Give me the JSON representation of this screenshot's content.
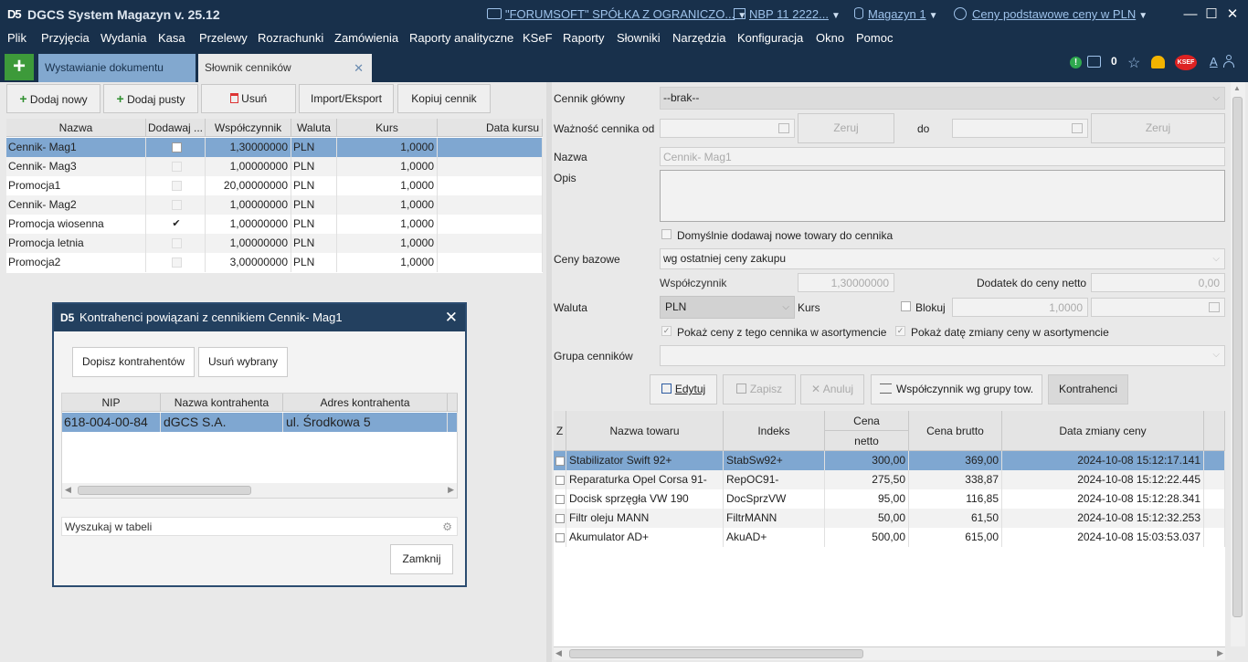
{
  "titlebar": {
    "logo": "D5",
    "title": "DGCS System Magazyn v. 25.12",
    "company": "\"FORUMSOFT\" SPÓŁKA Z OGRANICZO...",
    "nbp": "NBP 11 2222...",
    "warehouse": "Magazyn 1",
    "prices": "Ceny podstawowe ceny w PLN"
  },
  "menu": [
    "Plik",
    "Przyjęcia",
    "Wydania",
    "Kasa",
    "Przelewy",
    "Rozrachunki",
    "Zamówienia",
    "Raporty analityczne",
    "KSeF",
    "Raporty",
    "Słowniki",
    "Narzędzia",
    "Konfiguracja",
    "Okno",
    "Pomoc"
  ],
  "tabs": {
    "plus": "+",
    "tab1": "Wystawianie dokumentu",
    "tab2": "Słownik cenników",
    "close": "✕"
  },
  "status": {
    "count": "0",
    "ksef": "KSEF",
    "font": "A"
  },
  "toolbar": {
    "add_new": "Dodaj nowy",
    "add_empty": "Dodaj pusty",
    "delete": "Usuń",
    "import_export": "Import/Eksport",
    "copy": "Kopiuj cennik"
  },
  "pricelists": {
    "columns": [
      "Nazwa",
      "Dodawaj ...",
      "Współczynnik",
      "Waluta",
      "Kurs",
      "Data kursu"
    ],
    "rows": [
      {
        "name": "Cennik- Mag1",
        "add": "box",
        "factor": "1,30000000",
        "currency": "PLN",
        "rate": "1,0000",
        "selected": true
      },
      {
        "name": "Cennik- Mag3",
        "add": "dis",
        "factor": "1,00000000",
        "currency": "PLN",
        "rate": "1,0000"
      },
      {
        "name": "Promocja1",
        "add": "dis",
        "factor": "20,00000000",
        "currency": "PLN",
        "rate": "1,0000"
      },
      {
        "name": "Cennik- Mag2",
        "add": "dis",
        "factor": "1,00000000",
        "currency": "PLN",
        "rate": "1,0000"
      },
      {
        "name": "Promocja wiosenna",
        "add": "check",
        "factor": "1,00000000",
        "currency": "PLN",
        "rate": "1,0000"
      },
      {
        "name": "Promocja letnia",
        "add": "dis",
        "factor": "1,00000000",
        "currency": "PLN",
        "rate": "1,0000"
      },
      {
        "name": "Promocja2",
        "add": "dis",
        "factor": "3,00000000",
        "currency": "PLN",
        "rate": "1,0000"
      }
    ]
  },
  "form": {
    "main_label": "Cennik główny",
    "main_value": "--brak--",
    "validity_label": "Ważność cennika od",
    "clear": "Zeruj",
    "to": "do",
    "name_label": "Nazwa",
    "name_value": "Cennik- Mag1",
    "desc_label": "Opis",
    "default_add": "Domyślnie dodawaj nowe towary do cennika",
    "base_label": "Ceny bazowe",
    "base_value": "wg ostatniej ceny zakupu",
    "factor_label": "Współczynnik",
    "factor_value": "1,30000000",
    "addition_label": "Dodatek do ceny netto",
    "addition_value": "0,00",
    "currency_label": "Waluta",
    "currency_value": "PLN",
    "rate_label": "Kurs",
    "block_label": "Blokuj",
    "rate_value": "1,0000",
    "show_prices": "Pokaż ceny z tego cennika w asortymencie",
    "show_date": "Pokaż datę zmiany ceny w asortymencie",
    "group_label": "Grupa cenników"
  },
  "actions": {
    "edit": "Edytuj",
    "save": "Zapisz",
    "cancel": "Anuluj",
    "factor_group": "Współczynnik wg grupy tow.",
    "contractors": "Kontrahenci"
  },
  "products": {
    "columns": {
      "z": "Z",
      "name": "Nazwa towaru",
      "index": "Indeks",
      "net_top": "Cena",
      "net_bottom": "netto",
      "gross": "Cena brutto",
      "date": "Data zmiany ceny"
    },
    "rows": [
      {
        "name": "Stabilizator Swift 92+",
        "index": "StabSw92+",
        "net": "300,00",
        "gross": "369,00",
        "date": "2024-10-08 15:12:17.141",
        "selected": true
      },
      {
        "name": "Reparaturka Opel Corsa 91-",
        "index": "RepOC91-",
        "net": "275,50",
        "gross": "338,87",
        "date": "2024-10-08 15:12:22.445"
      },
      {
        "name": "Docisk sprzęgła VW 190",
        "index": "DocSprzVW",
        "net": "95,00",
        "gross": "116,85",
        "date": "2024-10-08 15:12:28.341"
      },
      {
        "name": "Filtr oleju MANN",
        "index": "FiltrMANN",
        "net": "50,00",
        "gross": "61,50",
        "date": "2024-10-08 15:12:32.253"
      },
      {
        "name": "Akumulator AD+",
        "index": "AkuAD+",
        "net": "500,00",
        "gross": "615,00",
        "date": "2024-10-08 15:03:53.037"
      }
    ]
  },
  "dialog": {
    "title": "Kontrahenci powiązani z cennikiem Cennik- Mag1",
    "add": "Dopisz kontrahentów",
    "remove": "Usuń wybrany",
    "columns": [
      "NIP",
      "Nazwa kontrahenta",
      "Adres kontrahenta"
    ],
    "rows": [
      {
        "nip": "618-004-00-84",
        "name": "dGCS S.A.",
        "address": "ul. Środkowa 5"
      }
    ],
    "search": "Wyszukaj w tabeli",
    "close": "Zamknij"
  }
}
